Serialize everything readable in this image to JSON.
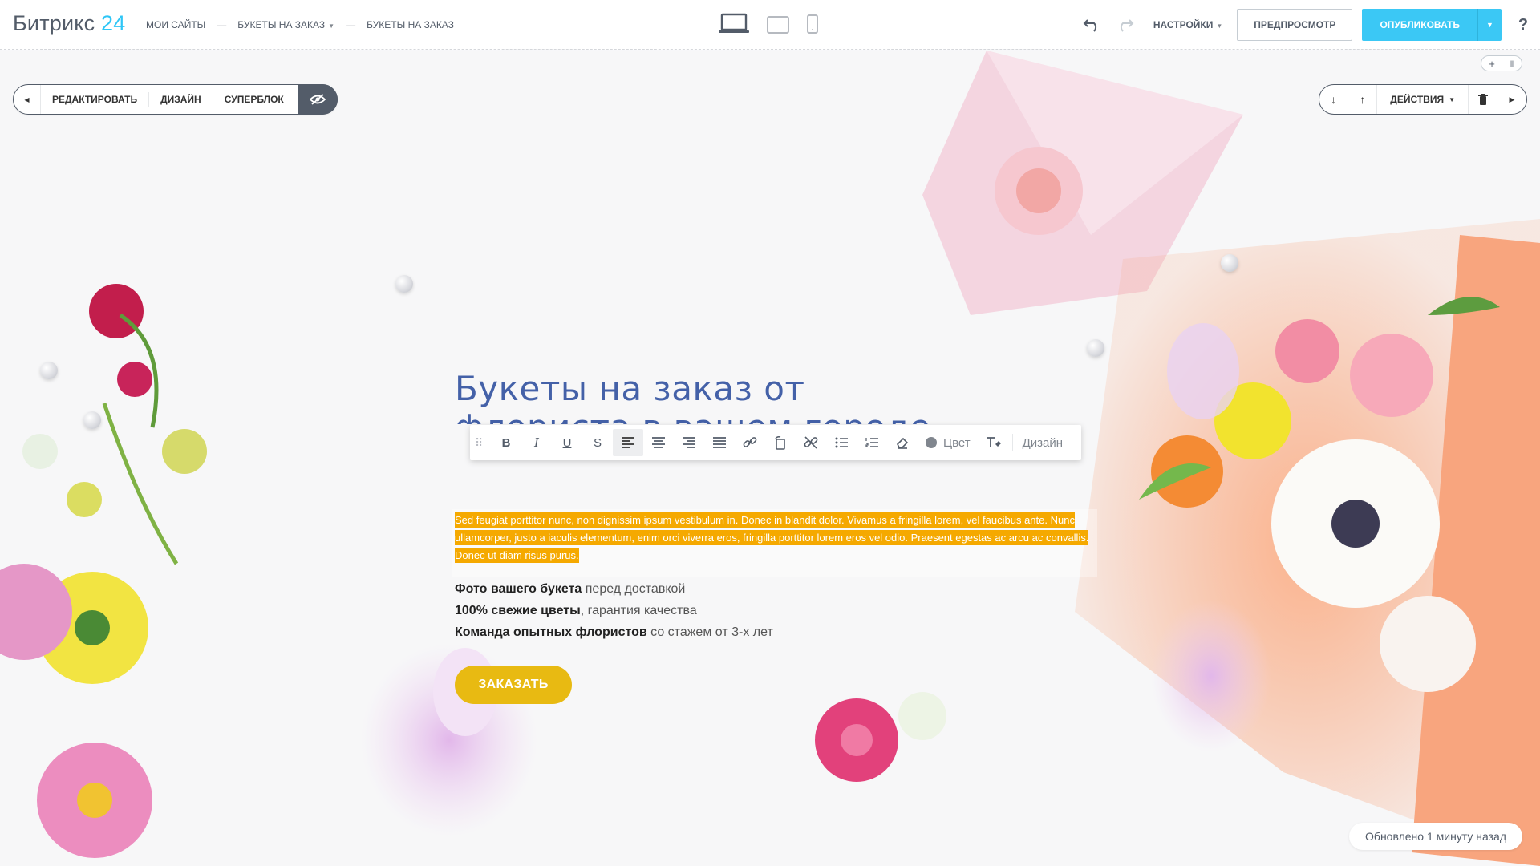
{
  "logo": {
    "text": "Битрикс",
    "num": "24"
  },
  "breadcrumbs": [
    {
      "label": "Мои сайты"
    },
    {
      "label": "Букеты на заказ"
    },
    {
      "label": "Букеты на заказ"
    }
  ],
  "header": {
    "settings_label": "Настройки",
    "preview_label": "Предпросмотр",
    "publish_label": "Опубликовать",
    "help_label": "?"
  },
  "block_toolbar": {
    "edit_label": "Редактировать",
    "design_label": "Дизайн",
    "superblock_label": "Суперблок",
    "actions_label": "Действия"
  },
  "hero": {
    "title_line1": "Букеты на заказ от",
    "title_line2": "флориста в вашем городе",
    "selected_text": "Sed feugiat porttitor nunc, non dignissim ipsum vestibulum in. Donec in blandit dolor. Vivamus a fringilla lorem, vel faucibus ante. Nunc ullamcorper, justo a iaculis elementum, enim orci viverra eros, fringilla porttitor lorem eros vel odio. Praesent egestas ac arcu ac convallis. Donec ut diam risus purus.",
    "features": [
      {
        "bold": "Фото вашего букета",
        "rest": " перед доставкой"
      },
      {
        "bold": "100% свежие цветы",
        "rest": ", гарантия качества"
      },
      {
        "bold": "Команда опытных флористов",
        "rest": " со стажем от 3-х лет"
      }
    ],
    "order_label": "ЗАКАЗАТЬ"
  },
  "format_toolbar": {
    "color_label": "Цвет",
    "design_label": "Дизайн"
  },
  "status": {
    "text": "Обновлено 1 минуту назад"
  },
  "colors": {
    "accent": "#3bc8f5",
    "title": "#4461a8",
    "highlight": "#f5a900",
    "order": "#e8ba12",
    "dark": "#535c69"
  }
}
